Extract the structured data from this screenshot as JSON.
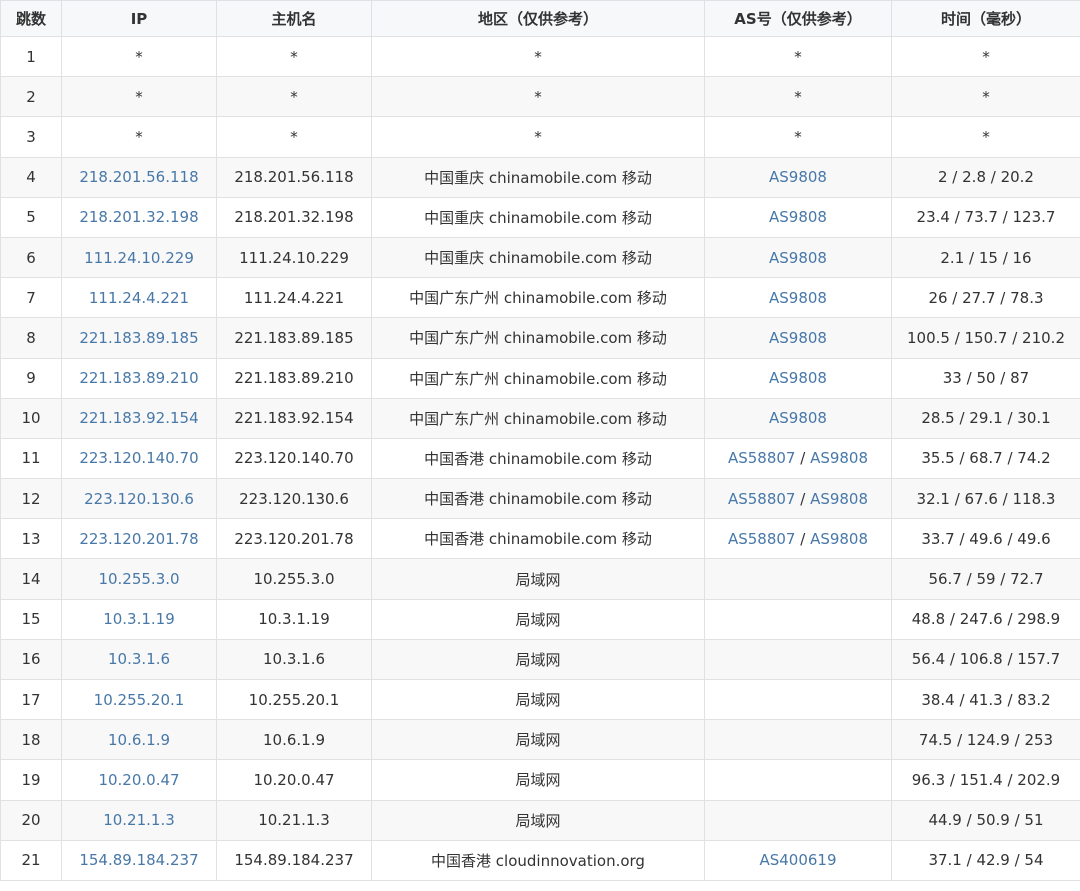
{
  "headers": {
    "hop": "跳数",
    "ip": "IP",
    "host": "主机名",
    "region": "地区（仅供参考）",
    "as": "AS号（仅供参考）",
    "time": "时间（毫秒）"
  },
  "as_separator": " / ",
  "rows": [
    {
      "hop": "1",
      "ip": "*",
      "host": "*",
      "region": "*",
      "as": [],
      "as_text": "*",
      "time": "*"
    },
    {
      "hop": "2",
      "ip": "*",
      "host": "*",
      "region": "*",
      "as": [],
      "as_text": "*",
      "time": "*"
    },
    {
      "hop": "3",
      "ip": "*",
      "host": "*",
      "region": "*",
      "as": [],
      "as_text": "*",
      "time": "*"
    },
    {
      "hop": "4",
      "ip": "218.201.56.118",
      "host": "218.201.56.118",
      "region": "中国重庆 chinamobile.com 移动",
      "as": [
        "AS9808"
      ],
      "time": "2 / 2.8 / 20.2"
    },
    {
      "hop": "5",
      "ip": "218.201.32.198",
      "host": "218.201.32.198",
      "region": "中国重庆 chinamobile.com 移动",
      "as": [
        "AS9808"
      ],
      "time": "23.4 / 73.7 / 123.7"
    },
    {
      "hop": "6",
      "ip": "111.24.10.229",
      "host": "111.24.10.229",
      "region": "中国重庆 chinamobile.com 移动",
      "as": [
        "AS9808"
      ],
      "time": "2.1 / 15 / 16"
    },
    {
      "hop": "7",
      "ip": "111.24.4.221",
      "host": "111.24.4.221",
      "region": "中国广东广州 chinamobile.com 移动",
      "as": [
        "AS9808"
      ],
      "time": "26 / 27.7 / 78.3"
    },
    {
      "hop": "8",
      "ip": "221.183.89.185",
      "host": "221.183.89.185",
      "region": "中国广东广州 chinamobile.com 移动",
      "as": [
        "AS9808"
      ],
      "time": "100.5 / 150.7 / 210.2"
    },
    {
      "hop": "9",
      "ip": "221.183.89.210",
      "host": "221.183.89.210",
      "region": "中国广东广州 chinamobile.com 移动",
      "as": [
        "AS9808"
      ],
      "time": "33 / 50 / 87"
    },
    {
      "hop": "10",
      "ip": "221.183.92.154",
      "host": "221.183.92.154",
      "region": "中国广东广州 chinamobile.com 移动",
      "as": [
        "AS9808"
      ],
      "time": "28.5 / 29.1 / 30.1"
    },
    {
      "hop": "11",
      "ip": "223.120.140.70",
      "host": "223.120.140.70",
      "region": "中国香港 chinamobile.com 移动",
      "as": [
        "AS58807",
        "AS9808"
      ],
      "time": "35.5 / 68.7 / 74.2"
    },
    {
      "hop": "12",
      "ip": "223.120.130.6",
      "host": "223.120.130.6",
      "region": "中国香港 chinamobile.com 移动",
      "as": [
        "AS58807",
        "AS9808"
      ],
      "time": "32.1 / 67.6 / 118.3"
    },
    {
      "hop": "13",
      "ip": "223.120.201.78",
      "host": "223.120.201.78",
      "region": "中国香港 chinamobile.com 移动",
      "as": [
        "AS58807",
        "AS9808"
      ],
      "time": "33.7 / 49.6 / 49.6"
    },
    {
      "hop": "14",
      "ip": "10.255.3.0",
      "host": "10.255.3.0",
      "region": "局域网",
      "as": [],
      "time": "56.7 / 59 / 72.7"
    },
    {
      "hop": "15",
      "ip": "10.3.1.19",
      "host": "10.3.1.19",
      "region": "局域网",
      "as": [],
      "time": "48.8 / 247.6 / 298.9"
    },
    {
      "hop": "16",
      "ip": "10.3.1.6",
      "host": "10.3.1.6",
      "region": "局域网",
      "as": [],
      "time": "56.4 / 106.8 / 157.7"
    },
    {
      "hop": "17",
      "ip": "10.255.20.1",
      "host": "10.255.20.1",
      "region": "局域网",
      "as": [],
      "time": "38.4 / 41.3 / 83.2"
    },
    {
      "hop": "18",
      "ip": "10.6.1.9",
      "host": "10.6.1.9",
      "region": "局域网",
      "as": [],
      "time": "74.5 / 124.9 / 253"
    },
    {
      "hop": "19",
      "ip": "10.20.0.47",
      "host": "10.20.0.47",
      "region": "局域网",
      "as": [],
      "time": "96.3 / 151.4 / 202.9"
    },
    {
      "hop": "20",
      "ip": "10.21.1.3",
      "host": "10.21.1.3",
      "region": "局域网",
      "as": [],
      "time": "44.9 / 50.9 / 51"
    },
    {
      "hop": "21",
      "ip": "154.89.184.237",
      "host": "154.89.184.237",
      "region": "中国香港 cloudinnovation.org",
      "as": [
        "AS400619"
      ],
      "time": "37.1 / 42.9 / 54"
    }
  ],
  "colors": {
    "link": "#4878a8",
    "header_bg": "#f6f8fa",
    "stripe_bg": "#f8f8f8",
    "border": "#dfe2e5"
  }
}
